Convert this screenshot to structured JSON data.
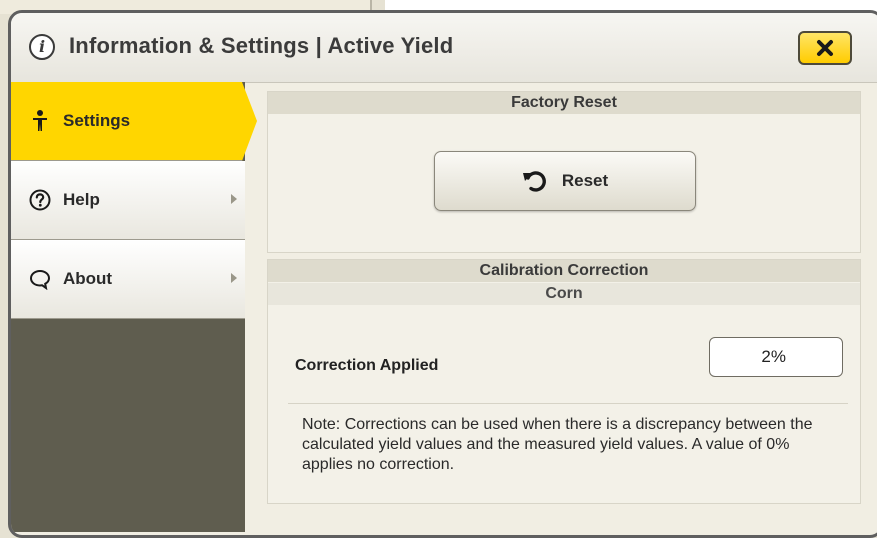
{
  "window": {
    "title": "Information & Settings | Active Yield"
  },
  "sidebar": {
    "items": [
      {
        "label": "Settings",
        "icon": "person-icon",
        "active": true
      },
      {
        "label": "Help",
        "icon": "question-circle-icon",
        "active": false
      },
      {
        "label": "About",
        "icon": "speech-bubble-icon",
        "active": false
      }
    ]
  },
  "factory_reset": {
    "header": "Factory Reset",
    "button_label": "Reset",
    "button_icon": "undo-arrow-icon"
  },
  "calibration": {
    "header": "Calibration Correction",
    "crop": "Corn",
    "correction_label": "Correction Applied",
    "correction_value": "2%",
    "note": "Note: Corrections can be used when there is a discrepancy between the calculated yield values and the measured yield values. A value of 0% applies no correction."
  },
  "colors": {
    "accent_yellow": "#ffd600",
    "sidebar_dark": "#5f5d4f",
    "panel_bg": "#f1eee3"
  }
}
